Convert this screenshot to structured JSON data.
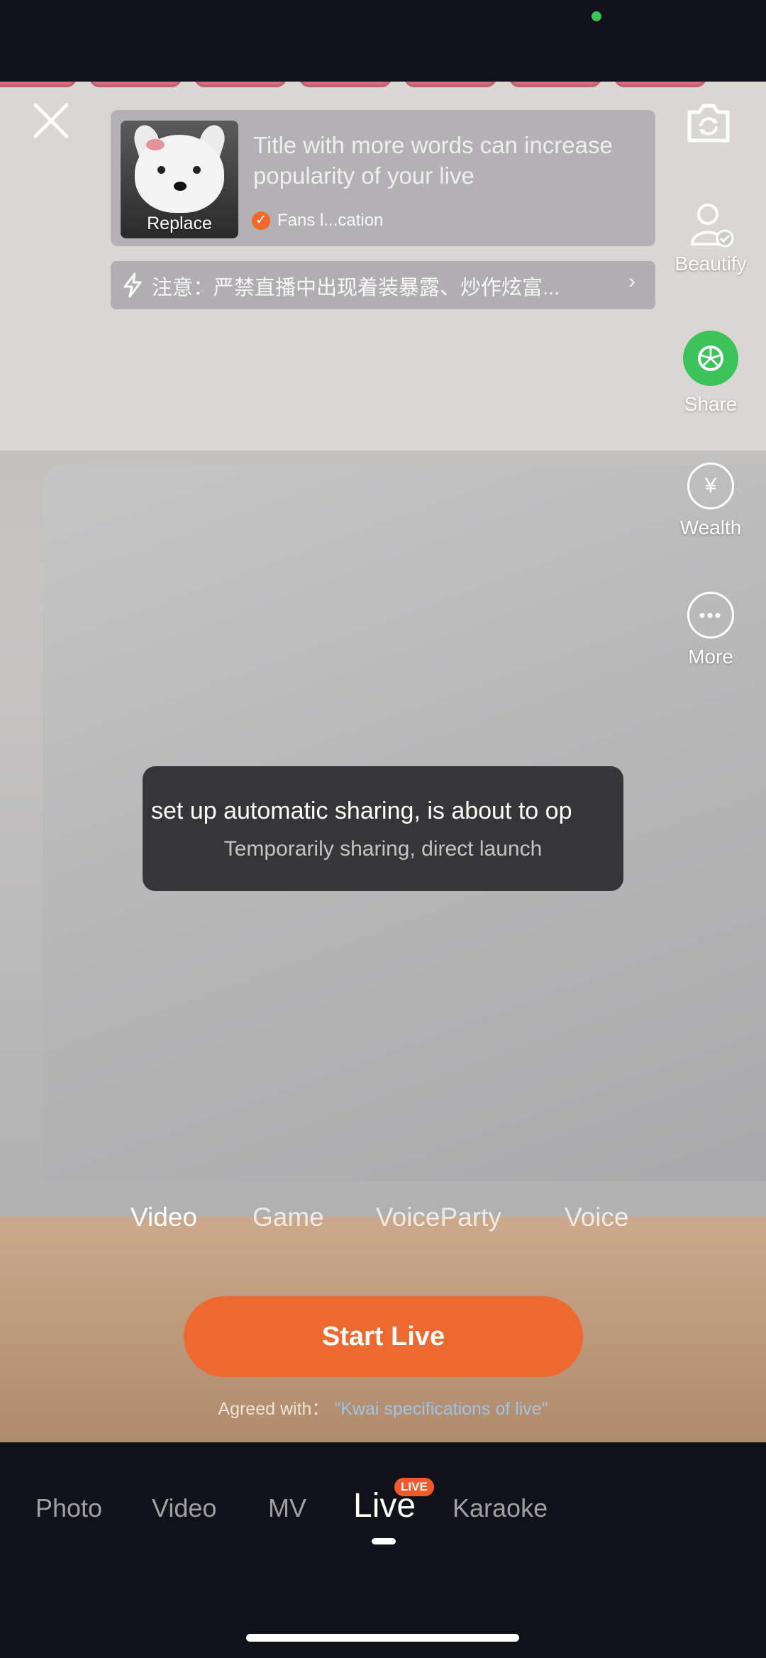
{
  "cover": {
    "replace_label": "Replace"
  },
  "title": {
    "placeholder_text": "Title with more words can increase popularity of your live"
  },
  "fans": {
    "label": "Fans l...cation"
  },
  "notice": {
    "text": "注意：严禁直播中出现着装暴露、炒作炫富...",
    "arrow": "›"
  },
  "right_rail": {
    "beautify_label": "Beautify",
    "share_label": "Share",
    "wealth_label": "Wealth",
    "more_label": "More"
  },
  "toast": {
    "message": "set up automatic sharing, is about to op",
    "sub": "Temporarily sharing, direct launch"
  },
  "modes": [
    "Video",
    "Game",
    "VoiceParty",
    "Voice"
  ],
  "start_button": "Start Live",
  "agreement": {
    "prefix": "Agreed with：",
    "link": "\"Kwai specifications of live\""
  },
  "bottom_nav": {
    "items": [
      "Photo",
      "Video",
      "MV",
      "Live",
      "Karaoke"
    ],
    "live_badge": "LIVE"
  },
  "colors": {
    "accent": "#ec6a2f",
    "share_green": "#3cc35a",
    "link": "#9fc3e6"
  },
  "icons": [
    "close-icon",
    "camera-flip-icon",
    "lightning-icon",
    "beautify-icon",
    "share-icon",
    "yen-icon",
    "more-dots-icon",
    "checkmark-icon"
  ]
}
